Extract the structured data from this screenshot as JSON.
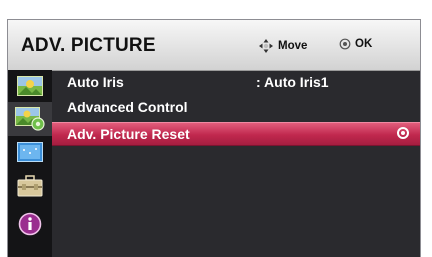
{
  "header": {
    "title": "ADV. PICTURE",
    "move_label": "Move",
    "ok_label": "OK"
  },
  "sidebar": {
    "items": [
      {
        "icon": "picture-icon",
        "selected": false
      },
      {
        "icon": "picture-settings-icon",
        "selected": true
      },
      {
        "icon": "screen-icon",
        "selected": false
      },
      {
        "icon": "toolbox-icon",
        "selected": false
      },
      {
        "icon": "info-icon",
        "selected": false
      }
    ]
  },
  "menu": {
    "items": [
      {
        "label": "Auto Iris",
        "value": ": Auto Iris1",
        "highlighted": false
      },
      {
        "label": "Advanced Control",
        "value": "",
        "highlighted": false
      },
      {
        "label": "Adv. Picture Reset",
        "value": "",
        "highlighted": true
      }
    ]
  },
  "colors": {
    "highlight": "#c0284e",
    "panel_bg": "#2a2a2e",
    "header_bg": "#e3e3e3"
  }
}
